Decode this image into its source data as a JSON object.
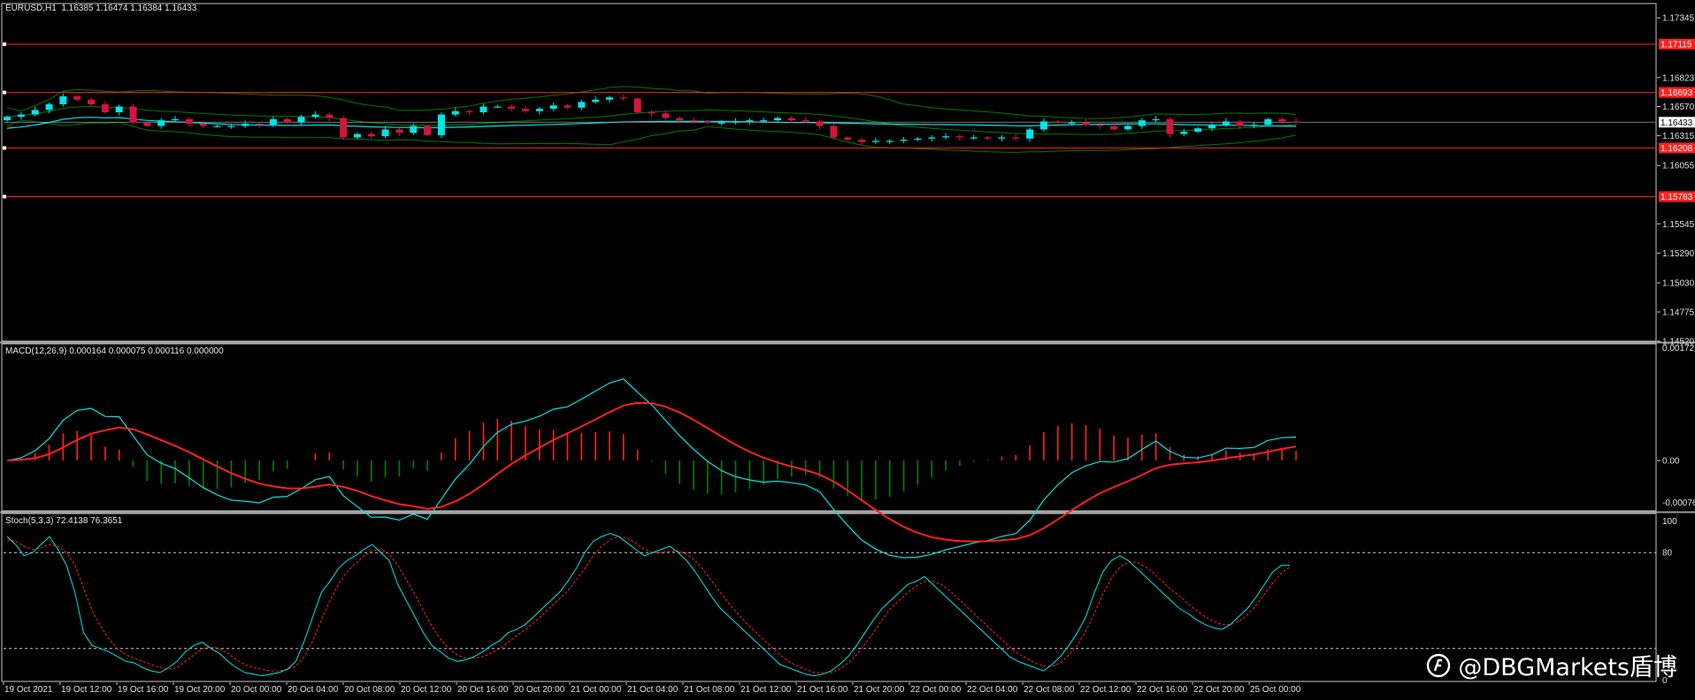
{
  "chart_data": [
    {
      "type": "candlestick",
      "title": "EURUSD,H1  1.16385 1.16474 1.16384 1.16433",
      "ylim": [
        1.1452,
        1.1747
      ],
      "y_ticks": [
        "1.17345",
        "1.16823",
        "1.16570",
        "1.16315",
        "1.16055",
        "1.15545",
        "1.15290",
        "1.15030",
        "1.14775",
        "1.14520"
      ],
      "last_price": "1.16433",
      "levels": [
        {
          "value": 1.17115,
          "label": "1.17115"
        },
        {
          "value": 1.16693,
          "label": "1.16693"
        },
        {
          "value": 1.16208,
          "label": "1.16208"
        },
        {
          "value": 1.15783,
          "label": "1.15783"
        }
      ],
      "x_labels": [
        "19 Oct 2021",
        "19 Oct 12:00",
        "19 Oct 16:00",
        "19 Oct 20:00",
        "20 Oct 00:00",
        "20 Oct 04:00",
        "20 Oct 08:00",
        "20 Oct 12:00",
        "20 Oct 16:00",
        "20 Oct 20:00",
        "21 Oct 00:00",
        "21 Oct 04:00",
        "21 Oct 08:00",
        "21 Oct 12:00",
        "21 Oct 16:00",
        "21 Oct 20:00",
        "22 Oct 00:00",
        "22 Oct 04:00",
        "22 Oct 08:00",
        "22 Oct 12:00",
        "22 Oct 16:00",
        "22 Oct 20:00",
        "25 Oct 00:00"
      ],
      "close": [
        1.1648,
        1.165,
        1.1654,
        1.1659,
        1.1666,
        1.1663,
        1.1659,
        1.1652,
        1.1657,
        1.1643,
        1.164,
        1.1645,
        1.1646,
        1.1642,
        1.164,
        1.164,
        1.164,
        1.1642,
        1.1641,
        1.1646,
        1.1643,
        1.1648,
        1.165,
        1.1647,
        1.163,
        1.1633,
        1.1631,
        1.1637,
        1.1634,
        1.164,
        1.1632,
        1.165,
        1.1653,
        1.1652,
        1.1657,
        1.1657,
        1.1655,
        1.1653,
        1.1655,
        1.1658,
        1.1656,
        1.1661,
        1.1663,
        1.1665,
        1.1664,
        1.1652,
        1.1651,
        1.1647,
        1.1645,
        1.1644,
        1.1643,
        1.1643,
        1.1644,
        1.1645,
        1.1645,
        1.1647,
        1.1645,
        1.1644,
        1.164,
        1.163,
        1.1628,
        1.1626,
        1.1627,
        1.1627,
        1.1628,
        1.1629,
        1.163,
        1.1631,
        1.163,
        1.163,
        1.1629,
        1.163,
        1.1629,
        1.1637,
        1.1644,
        1.1643,
        1.1643,
        1.1641,
        1.164,
        1.1637,
        1.164,
        1.1645,
        1.1646,
        1.1633,
        1.1635,
        1.1638,
        1.1641,
        1.1644,
        1.164,
        1.1641,
        1.1646,
        1.1644,
        1.1643
      ],
      "macd": {
        "title": "MACD(12,26,9) 0.000164 0.000075 0.000116 0.000000",
        "y_ticks": [
          "0.00172",
          "0.00",
          "-0.000767"
        ]
      },
      "stochastic": {
        "title": "Stoch(5,3,3) 72.4138 76.3651",
        "y_ticks": [
          "100",
          "80",
          "0"
        ],
        "levels": [
          80,
          20
        ],
        "k": [
          90,
          85,
          78,
          80,
          85,
          90,
          82,
          72,
          55,
          30,
          22,
          20,
          18,
          15,
          12,
          11,
          8,
          6,
          5,
          8,
          12,
          18,
          22,
          24,
          20,
          17,
          12,
          8,
          5,
          4,
          3,
          4,
          5,
          7,
          12,
          25,
          40,
          55,
          62,
          70,
          75,
          78,
          82,
          85,
          80,
          75,
          60,
          50,
          40,
          30,
          22,
          18,
          14,
          12,
          13,
          15,
          18,
          22,
          25,
          30,
          32,
          35,
          40,
          45,
          50,
          55,
          62,
          70,
          80,
          87,
          90,
          92,
          90,
          86,
          82,
          78,
          80,
          82,
          84,
          80,
          75,
          68,
          60,
          52,
          45,
          40,
          35,
          30,
          25,
          20,
          15,
          10,
          8,
          6,
          4,
          3,
          4,
          6,
          10,
          15,
          22,
          30,
          38,
          45,
          50,
          55,
          60,
          62,
          65,
          60,
          55,
          50,
          45,
          40,
          35,
          30,
          25,
          20,
          15,
          12,
          10,
          8,
          6,
          10,
          15,
          22,
          30,
          40,
          55,
          68,
          75,
          78,
          75,
          70,
          65,
          60,
          55,
          50,
          45,
          42,
          38,
          35,
          33,
          32,
          35,
          40,
          45,
          52,
          60,
          68,
          72,
          72
        ],
        "d": [
          88,
          87,
          84,
          82,
          83,
          85,
          84,
          80,
          72,
          58,
          44,
          34,
          26,
          20,
          16,
          14,
          12,
          10,
          8,
          7,
          8,
          12,
          16,
          20,
          21,
          20,
          17,
          13,
          10,
          8,
          7,
          6,
          6,
          7,
          9,
          15,
          25,
          38,
          50,
          60,
          68,
          73,
          78,
          81,
          82,
          79,
          72,
          63,
          54,
          44,
          34,
          26,
          20,
          16,
          14,
          14,
          15,
          17,
          20,
          24,
          28,
          32,
          36,
          41,
          46,
          51,
          56,
          63,
          70,
          78,
          84,
          88,
          90,
          89,
          86,
          82,
          80,
          80,
          81,
          81,
          79,
          75,
          69,
          62,
          55,
          48,
          42,
          36,
          31,
          26,
          21,
          16,
          12,
          9,
          7,
          5,
          5,
          5,
          7,
          11,
          16,
          23,
          30,
          38,
          45,
          50,
          55,
          59,
          62,
          62,
          60,
          56,
          51,
          46,
          41,
          36,
          31,
          26,
          21,
          17,
          14,
          11,
          9,
          9,
          11,
          16,
          22,
          31,
          42,
          54,
          64,
          71,
          74,
          74,
          71,
          67,
          62,
          57,
          53,
          48,
          44,
          40,
          37,
          35,
          35,
          37,
          41,
          47,
          54,
          61,
          67,
          71
        ]
      }
    }
  ],
  "watermark": "@DBGMarkets盾博",
  "colors": {
    "bull": "#00e5e5",
    "bear": "#d4143c",
    "level": "#ff2020",
    "bands": "#007a00",
    "macd_signal": "#ff2020",
    "macd_main": "#00e5e5",
    "hist_pos": "#ff2020",
    "hist_neg": "#008000"
  }
}
